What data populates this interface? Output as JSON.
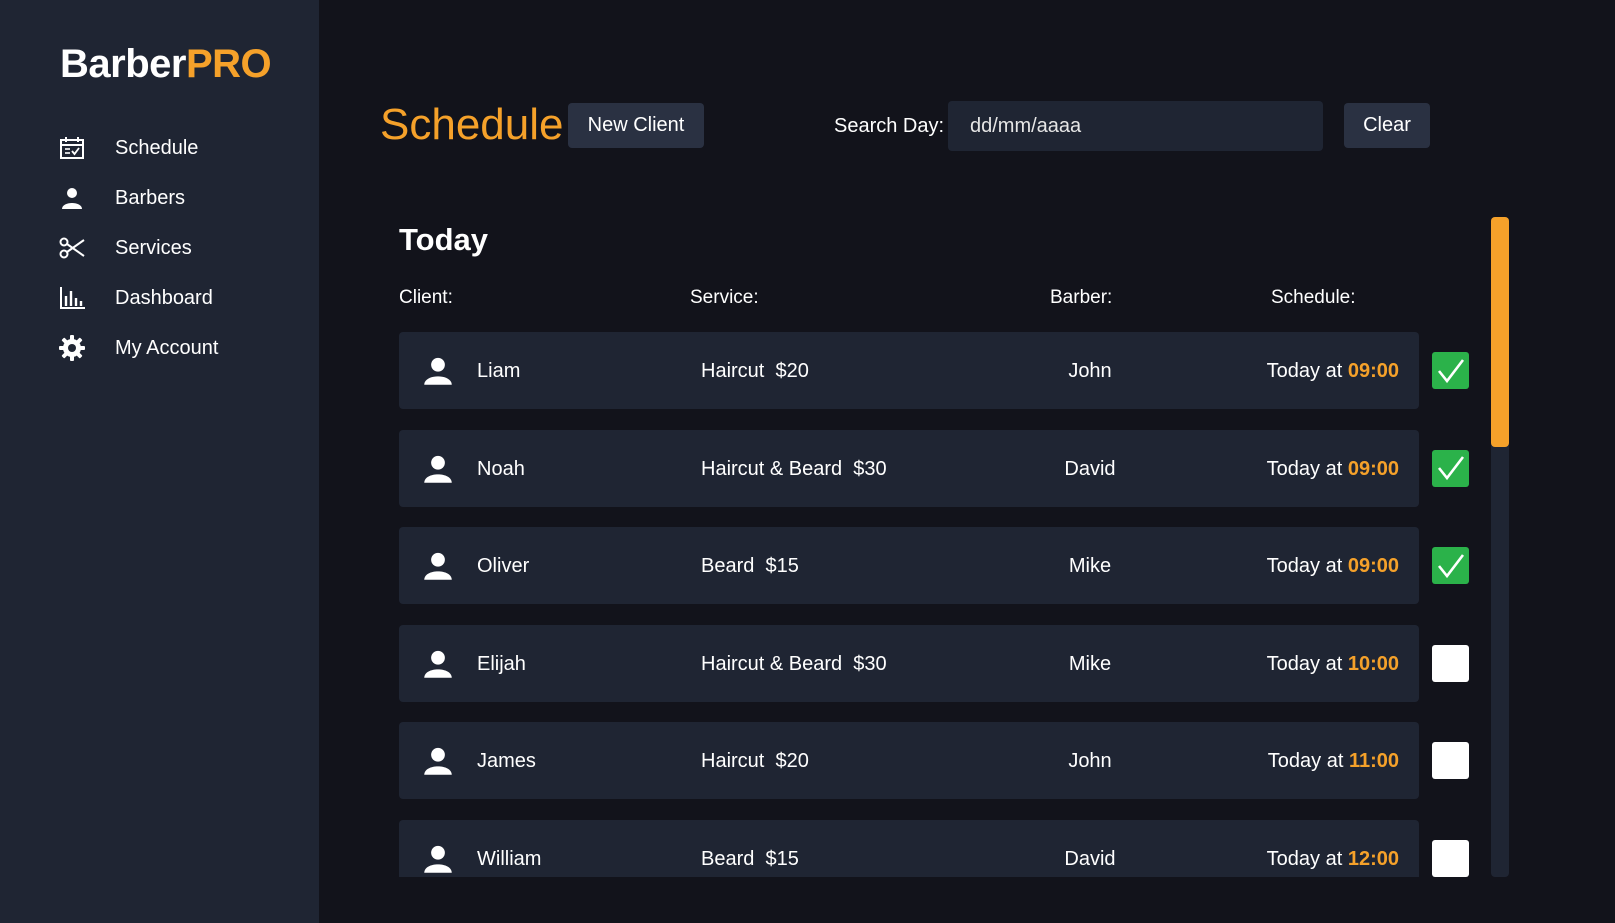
{
  "brand": {
    "part1": "Barber",
    "part2": "PRO"
  },
  "colors": {
    "accent": "#f5a12a",
    "sidebar": "#1f2533",
    "background": "#12131b",
    "checked": "#2bb24a"
  },
  "sidebar": {
    "items": [
      {
        "label": "Schedule",
        "icon": "calendar-check-icon"
      },
      {
        "label": "Barbers",
        "icon": "user-icon"
      },
      {
        "label": "Services",
        "icon": "scissors-icon"
      },
      {
        "label": "Dashboard",
        "icon": "bar-chart-icon"
      },
      {
        "label": "My Account",
        "icon": "gear-icon"
      }
    ]
  },
  "header": {
    "title": "Schedule",
    "new_client_label": "New Client",
    "search_label": "Search Day:",
    "search_placeholder": "dd/mm/aaaa",
    "clear_label": "Clear"
  },
  "section": {
    "title": "Today",
    "columns": {
      "client": "Client:",
      "service": "Service:",
      "barber": "Barber:",
      "schedule": "Schedule:"
    }
  },
  "appointments": [
    {
      "client": "Liam",
      "service": "Haircut  $20",
      "barber": "John",
      "day": "Today at ",
      "time": "09:00",
      "done": true
    },
    {
      "client": "Noah",
      "service": "Haircut & Beard  $30",
      "barber": "David",
      "day": "Today at ",
      "time": "09:00",
      "done": true
    },
    {
      "client": "Oliver",
      "service": "Beard  $15",
      "barber": "Mike",
      "day": "Today at ",
      "time": "09:00",
      "done": true
    },
    {
      "client": "Elijah",
      "service": "Haircut & Beard  $30",
      "barber": "Mike",
      "day": "Today at ",
      "time": "10:00",
      "done": false
    },
    {
      "client": "James",
      "service": "Haircut  $20",
      "barber": "John",
      "day": "Today at ",
      "time": "11:00",
      "done": false
    },
    {
      "client": "William",
      "service": "Beard  $15",
      "barber": "David",
      "day": "Today at ",
      "time": "12:00",
      "done": false
    }
  ]
}
